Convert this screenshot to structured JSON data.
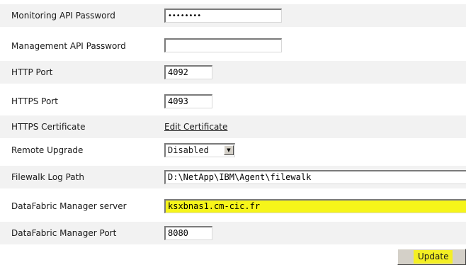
{
  "form": {
    "monitoring_api_password": {
      "label": "Monitoring API Password",
      "value": "••••••••"
    },
    "management_api_password": {
      "label": "Management API Password",
      "value": ""
    },
    "http_port": {
      "label": "HTTP Port",
      "value": "4092"
    },
    "https_port": {
      "label": "HTTPS Port",
      "value": "4093"
    },
    "https_certificate": {
      "label": "HTTPS Certificate",
      "link": "Edit Certificate"
    },
    "remote_upgrade": {
      "label": "Remote Upgrade",
      "selected": "Disabled"
    },
    "filewalk_log_path": {
      "label": "Filewalk Log Path",
      "value": "D:\\NetApp\\IBM\\Agent\\filewalk"
    },
    "datafabric_manager_server": {
      "label": "DataFabric Manager server",
      "value": "ksxbnas1.cm-cic.fr"
    },
    "datafabric_manager_port": {
      "label": "DataFabric Manager Port",
      "value": "8080"
    }
  },
  "actions": {
    "update_label": "Update"
  },
  "colors": {
    "highlight": "#f6f51a",
    "row_shade": "#f2f2f2"
  },
  "icons": {
    "select_arrow": "chevron-down-icon"
  }
}
